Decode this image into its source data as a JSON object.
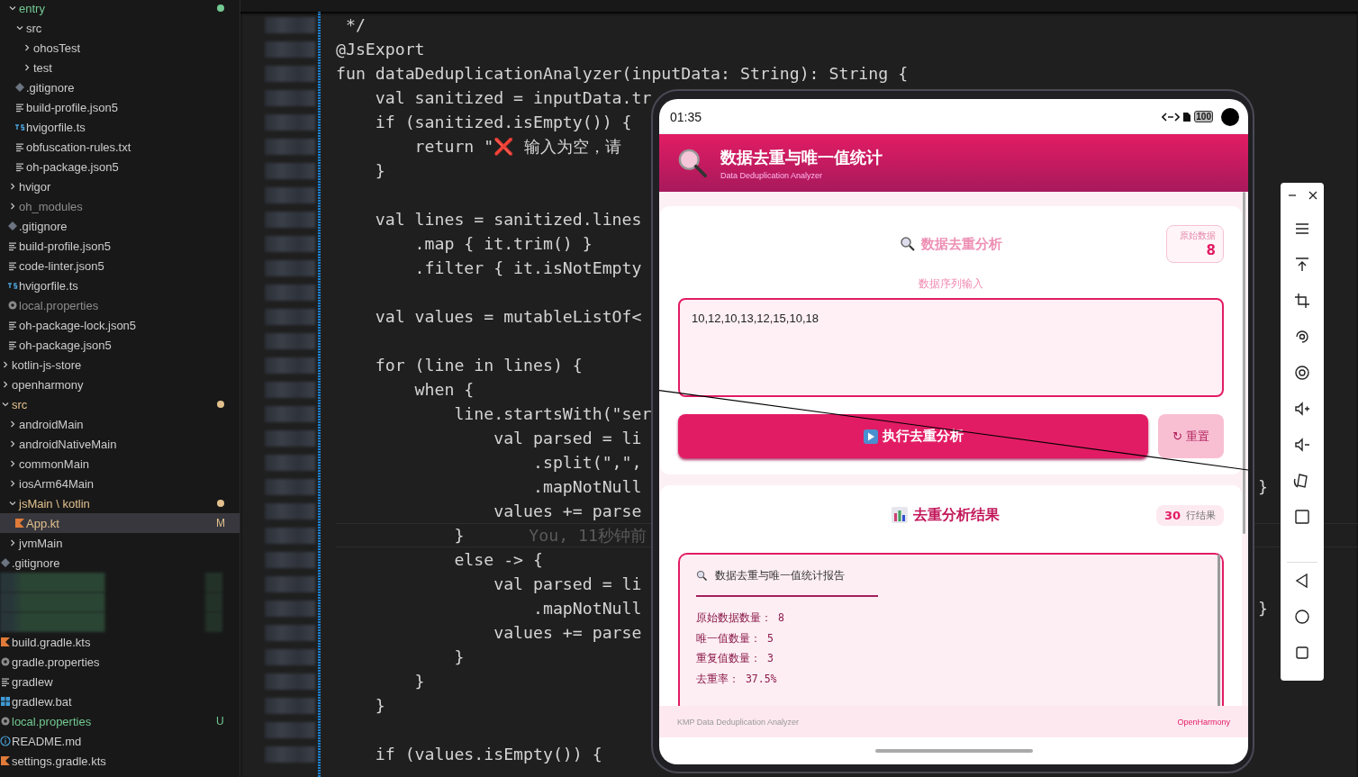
{
  "sidebar": {
    "nested_items": [
      {
        "label": "entry",
        "kind": "folder",
        "expanded": true,
        "selected": false,
        "color": "#73c991",
        "dot": true,
        "children": [
          {
            "label": "src",
            "kind": "folder",
            "expanded": true,
            "selected": false,
            "children": [
              {
                "label": "ohosTest",
                "kind": "folder",
                "expanded": false,
                "selected": false
              },
              {
                "label": "test",
                "kind": "folder",
                "expanded": false,
                "selected": false
              }
            ]
          },
          {
            "label": ".gitignore",
            "kind": "git",
            "selected": false
          },
          {
            "label": "build-profile.json5",
            "kind": "lines",
            "selected": false
          },
          {
            "label": "hvigorfile.ts",
            "kind": "ts",
            "selected": false
          },
          {
            "label": "obfuscation-rules.txt",
            "kind": "lines",
            "selected": false
          },
          {
            "label": "oh-package.json5",
            "kind": "lines",
            "selected": false
          }
        ]
      },
      {
        "label": "hvigor",
        "kind": "folder",
        "expanded": false,
        "selected": false
      },
      {
        "label": "oh_modules",
        "kind": "folder",
        "expanded": false,
        "selected": false,
        "color": "#8c8c8c"
      },
      {
        "label": ".gitignore",
        "kind": "git",
        "selected": false
      },
      {
        "label": "build-profile.json5",
        "kind": "lines",
        "selected": false
      },
      {
        "label": "code-linter.json5",
        "kind": "lines",
        "selected": false
      },
      {
        "label": "hvigorfile.ts",
        "kind": "ts",
        "selected": false
      },
      {
        "label": "local.properties",
        "kind": "gear",
        "selected": false,
        "color": "#8c8c8c"
      },
      {
        "label": "oh-package-lock.json5",
        "kind": "lines",
        "selected": false
      },
      {
        "label": "oh-package.json5",
        "kind": "lines",
        "selected": false
      }
    ],
    "items": [
      {
        "label": "kotlin-js-store",
        "kind": "folder",
        "expanded": false,
        "selected": false
      },
      {
        "label": "openharmony",
        "kind": "folder",
        "expanded": false,
        "selected": false
      },
      {
        "label": "src",
        "kind": "folder",
        "expanded": true,
        "selected": false,
        "color": "#e2c08d",
        "dot": true,
        "children": [
          {
            "label": "androidMain",
            "kind": "folder",
            "expanded": false,
            "selected": false
          },
          {
            "label": "androidNativeMain",
            "kind": "folder",
            "expanded": false,
            "selected": false
          },
          {
            "label": "commonMain",
            "kind": "folder",
            "expanded": false,
            "selected": false
          },
          {
            "label": "iosArm64Main",
            "kind": "folder",
            "expanded": false,
            "selected": false
          },
          {
            "label": "jsMain \\ kotlin",
            "kind": "folder",
            "expanded": true,
            "selected": false,
            "color": "#e2c08d",
            "dot": true,
            "children": [
              {
                "label": "App.kt",
                "kind": "kotlin",
                "selected": true,
                "color": "#e2c08d",
                "badge": "M"
              }
            ]
          },
          {
            "label": "jvmMain",
            "kind": "folder",
            "expanded": false,
            "selected": false
          }
        ]
      },
      {
        "label": ".gitignore",
        "kind": "git",
        "selected": false
      }
    ],
    "bottom_items": [
      {
        "label": "build.gradle.kts",
        "kind": "kotlin",
        "selected": false
      },
      {
        "label": "gradle.properties",
        "kind": "gear",
        "selected": false
      },
      {
        "label": "gradlew",
        "kind": "lines",
        "selected": false
      },
      {
        "label": "gradlew.bat",
        "kind": "windows",
        "selected": false
      },
      {
        "label": "local.properties",
        "kind": "gear",
        "selected": false,
        "color": "#73c991",
        "badge": "U"
      },
      {
        "label": "README.md",
        "kind": "info",
        "selected": false
      },
      {
        "label": "settings.gradle.kts",
        "kind": "kotlin",
        "selected": false
      }
    ]
  },
  "editor": {
    "lines": [
      {
        "text": " */",
        "current": false
      },
      {
        "text": "@JsExport",
        "current": false
      },
      {
        "text": "fun dataDeduplicationAnalyzer(inputData: String): String {",
        "current": false
      },
      {
        "text": "    val sanitized = inputData.tr",
        "current": false
      },
      {
        "text": "    if (sanitized.isEmpty()) {",
        "current": false
      },
      {
        "text": "        return \"❌ 输入为空，请",
        "current": false
      },
      {
        "text": "    }",
        "current": false
      },
      {
        "current": false
      },
      {
        "text": "    val lines = sanitized.lines",
        "current": false
      },
      {
        "text": "        .map { it.trim() }",
        "current": false
      },
      {
        "text": "        .filter { it.isNotEmpty",
        "current": false
      },
      {
        "current": false
      },
      {
        "text": "    val values = mutableListOf<",
        "current": false
      },
      {
        "current": false
      },
      {
        "text": "    for (line in lines) {",
        "current": false
      },
      {
        "text": "        when {",
        "current": false
      },
      {
        "text": "            line.startsWith(\"ser",
        "current": false
      },
      {
        "text": "                val parsed = li",
        "current": false
      },
      {
        "text": "                    .split(\",\",",
        "current": false
      },
      {
        "text": "                    .mapNotNull",
        "tail": "}",
        "current": false
      },
      {
        "text": "                values += parse",
        "current": false
      },
      {
        "text": "            }",
        "blame": "You, 11秒钟前",
        "current": true
      },
      {
        "text": "            else -> {",
        "current": false
      },
      {
        "text": "                val parsed = li",
        "current": false
      },
      {
        "text": "                    .mapNotNull",
        "tail": "}",
        "current": false
      },
      {
        "text": "                values += parse",
        "current": false
      },
      {
        "text": "            }",
        "current": false
      },
      {
        "text": "        }",
        "current": false
      },
      {
        "text": "    }",
        "current": false
      },
      {
        "current": false
      },
      {
        "text": "    if (values.isEmpty()) {",
        "current": false
      }
    ]
  },
  "phone": {
    "status_bar": {
      "time": "01:35",
      "battery": "100"
    },
    "header": {
      "title": "数据去重与唯一值统计",
      "subtitle": "Data Deduplication Analyzer"
    },
    "input_card": {
      "title": "数据去重分析",
      "stat": {
        "label": "原始数据",
        "value": "8"
      },
      "field_label": "数据序列输入",
      "value": "10,12,10,13,12,15,10,18",
      "primary_button": "执行去重分析",
      "secondary_button": "↻ 重置"
    },
    "result_card": {
      "title": "去重分析结果",
      "badge": {
        "value": "30",
        "label": "行结果"
      },
      "report": {
        "title": "数据去重与唯一值统计报告",
        "lines": [
          "原始数据数量： 8",
          "唯一值数量： 5",
          "重复值数量： 3",
          "去重率： 37.5%"
        ]
      }
    },
    "footer": {
      "left": "KMP Data Deduplication Analyzer",
      "right": "OpenHarmony"
    }
  }
}
